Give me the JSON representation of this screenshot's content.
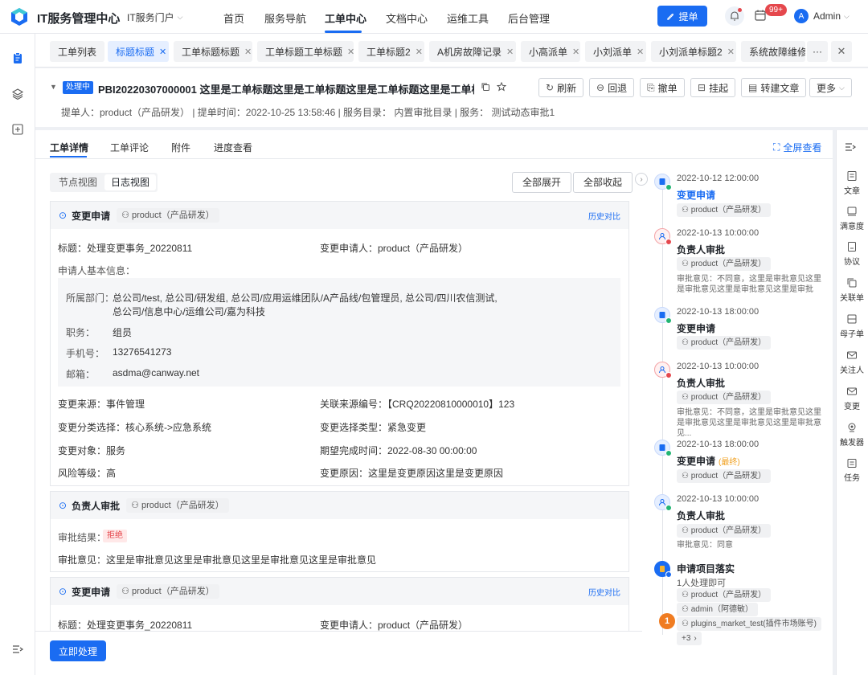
{
  "header": {
    "app_title": "IT服务管理中心",
    "portal": "IT服务门户",
    "nav": [
      "首页",
      "服务导航",
      "工单中心",
      "文档中心",
      "运维工具",
      "后台管理"
    ],
    "submit": "提单",
    "badge": "99+",
    "avatar": "A",
    "user": "Admin"
  },
  "tabs": [
    "工单列表",
    "标题标题",
    "工单标题标题",
    "工单标题工单标题",
    "工单标题2",
    "A机房故障记录",
    "小高派单",
    "小刘派单",
    "小刘派单标题2",
    "系统故障维修"
  ],
  "tabs_more": "···",
  "ticket": {
    "status": "处理中",
    "title": "PBI20220307000001 这里是工单标题这里是工单标题这里是工单标题这里是工单标题这里是工",
    "buttons": [
      "刷新",
      "回退",
      "撤单",
      "挂起",
      "转建文章",
      "更多"
    ],
    "meta": "提单人：product（产品研发） | 提单时间：2022-10-25 13:58:46 | 服务目录：  内置审批目录 | 服务：  测试动态审批1"
  },
  "subtabs": [
    "工单详情",
    "工单评论",
    "附件",
    "进度查看"
  ],
  "fullscreen": "全屏查看",
  "views": [
    "节点视图",
    "日志视图"
  ],
  "expand_all": "全部展开",
  "collapse_all": "全部收起",
  "sec1": {
    "title": "变更申请",
    "user": "product（产品研发）",
    "history": "历史对比",
    "title_field": "标题：处理变更事务_20220811",
    "applicant": "变更申请人：product（产品研发）",
    "basic_info": "申请人基本信息：",
    "dept_label": "所属部门：",
    "dept_1": "总公司/test, 总公司/研发组, 总公司/应用运维团队/A产品线/包管理员, 总公司/四川农信测试,",
    "dept_2": "总公司/信息中心/运维公司/嘉为科技",
    "job_label": "职务：",
    "job": "组员",
    "phone_label": "手机号：",
    "phone": "13276541273",
    "email_label": "邮箱：",
    "email": "asdma@canway.net",
    "rows": [
      [
        "变更来源：事件管理",
        "关联来源编号：【CRQ20220810000010】123"
      ],
      [
        "变更分类选择：核心系统->应急系统",
        "变更选择类型：紧急变更"
      ],
      [
        "变更对象：服务",
        "期望完成时间：2022-08-30 00:00:00"
      ],
      [
        "风险等级：高",
        "变更原因：这里是变更原因这里是变更原因"
      ]
    ]
  },
  "sec2": {
    "title": "负责人审批",
    "user": "product（产品研发）",
    "result_label": "审批结果：",
    "result": "拒绝",
    "opinion": "审批意见：这里是审批意见这里是审批意见这里是审批意见这里是审批意见"
  },
  "sec3": {
    "title": "变更申请",
    "user": "product（产品研发）",
    "history": "历史对比",
    "title_field": "标题：处理变更事务_20220811",
    "applicant": "变更申请人：product（产品研发）"
  },
  "process_btn": "立即处理",
  "timeline": [
    {
      "time": "2022-10-12 12:00:00",
      "title": "变更申请",
      "user": "product（产品研发）"
    },
    {
      "time": "2022-10-13 10:00:00",
      "title": "负责人审批",
      "user": "product（产品研发）",
      "note": "审批意见：不同意，这里是审批意见这里是审批意见这里是审批意见这里是审批"
    },
    {
      "time": "2022-10-13 18:00:00",
      "title": "变更申请",
      "user": "product（产品研发）"
    },
    {
      "time": "2022-10-13 10:00:00",
      "title": "负责人审批",
      "user": "product（产品研发）",
      "note": "审批意见：不同意，这里是审批意见这里是审批意见这里是审批意见这里是审批意见..."
    },
    {
      "time": "2022-10-13 18:00:00",
      "title": "变更申请",
      "tag": "(最终)",
      "user": "product（产品研发）"
    },
    {
      "time": "2022-10-13 10:00:00",
      "title": "负责人审批",
      "user": "product（产品研发）",
      "note": "审批意见：同意"
    }
  ],
  "tl_last": {
    "title": "申请项目落实",
    "sub": "1人处理即可",
    "users": [
      "product（产品研发）",
      "admin（阿德敏）",
      "plugins_market_test(插件市场账号)"
    ],
    "more": "+3"
  },
  "step_badge": "1",
  "right_rail": [
    "文章",
    "满意度",
    "协议",
    "关联单",
    "母子单",
    "关注人",
    "变更",
    "触发器",
    "任务"
  ],
  "colors": {
    "accent": "#1a6cf2",
    "danger": "#e5484d",
    "success": "#22b573",
    "step": "#f07c21"
  }
}
